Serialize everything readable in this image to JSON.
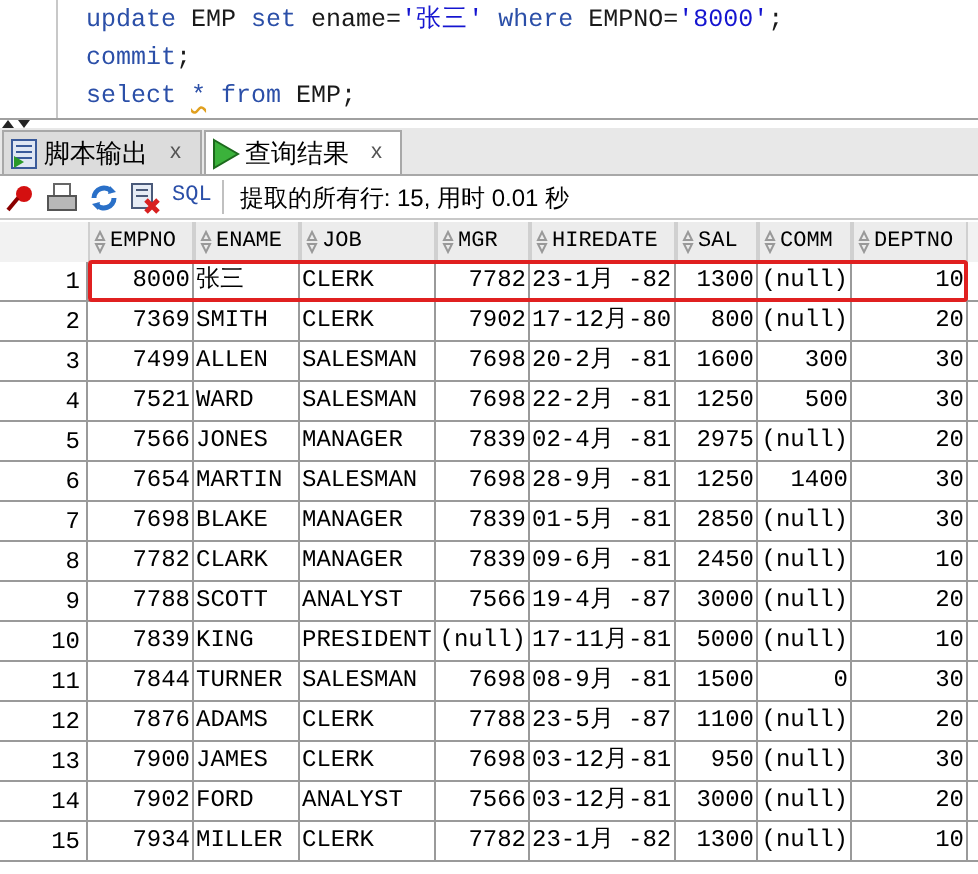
{
  "editor": {
    "lines": [
      [
        {
          "kind": "keyword",
          "text": "update"
        },
        {
          "kind": "ident",
          "text": " EMP "
        },
        {
          "kind": "keyword",
          "text": "set"
        },
        {
          "kind": "ident",
          "text": " ename="
        },
        {
          "kind": "string",
          "text": "'张三' "
        },
        {
          "kind": "keyword",
          "text": "where"
        },
        {
          "kind": "ident",
          "text": " EMPNO="
        },
        {
          "kind": "string",
          "text": "'8000'"
        },
        {
          "kind": "ident",
          "text": ";"
        }
      ],
      [
        {
          "kind": "keyword",
          "text": "commit"
        },
        {
          "kind": "ident",
          "text": ";"
        }
      ],
      [
        {
          "kind": "keyword",
          "text": "select "
        },
        {
          "kind": "keyword",
          "text": "*",
          "warning": true
        },
        {
          "kind": "keyword",
          "text": " from"
        },
        {
          "kind": "ident",
          "text": " EMP;"
        }
      ]
    ]
  },
  "tabs": [
    {
      "label": "脚本输出",
      "close": "x",
      "selected": false
    },
    {
      "label": "查询结果",
      "close": "x",
      "selected": true
    }
  ],
  "toolbar": {
    "sql_button": "SQL",
    "status": "提取的所有行: 15, 用时 0.01 秒"
  },
  "table": {
    "columns": [
      {
        "label": "EMPNO",
        "kind": "number"
      },
      {
        "label": "ENAME",
        "kind": "text"
      },
      {
        "label": "JOB",
        "kind": "text"
      },
      {
        "label": "MGR",
        "kind": "number"
      },
      {
        "label": "HIREDATE",
        "kind": "text"
      },
      {
        "label": "SAL",
        "kind": "number"
      },
      {
        "label": "COMM",
        "kind": "number"
      },
      {
        "label": "DEPTNO",
        "kind": "number"
      }
    ],
    "rows": [
      {
        "num": "1",
        "highlighted": true,
        "cells": [
          "8000",
          "张三",
          "CLERK",
          "7782",
          "23-1月 -82",
          "1300",
          "(null)",
          "10"
        ]
      },
      {
        "num": "2",
        "highlighted": false,
        "cells": [
          "7369",
          "SMITH",
          "CLERK",
          "7902",
          "17-12月-80",
          "800",
          "(null)",
          "20"
        ]
      },
      {
        "num": "3",
        "highlighted": false,
        "cells": [
          "7499",
          "ALLEN",
          "SALESMAN",
          "7698",
          "20-2月 -81",
          "1600",
          "300",
          "30"
        ]
      },
      {
        "num": "4",
        "highlighted": false,
        "cells": [
          "7521",
          "WARD",
          "SALESMAN",
          "7698",
          "22-2月 -81",
          "1250",
          "500",
          "30"
        ]
      },
      {
        "num": "5",
        "highlighted": false,
        "cells": [
          "7566",
          "JONES",
          "MANAGER",
          "7839",
          "02-4月 -81",
          "2975",
          "(null)",
          "20"
        ]
      },
      {
        "num": "6",
        "highlighted": false,
        "cells": [
          "7654",
          "MARTIN",
          "SALESMAN",
          "7698",
          "28-9月 -81",
          "1250",
          "1400",
          "30"
        ]
      },
      {
        "num": "7",
        "highlighted": false,
        "cells": [
          "7698",
          "BLAKE",
          "MANAGER",
          "7839",
          "01-5月 -81",
          "2850",
          "(null)",
          "30"
        ]
      },
      {
        "num": "8",
        "highlighted": false,
        "cells": [
          "7782",
          "CLARK",
          "MANAGER",
          "7839",
          "09-6月 -81",
          "2450",
          "(null)",
          "10"
        ]
      },
      {
        "num": "9",
        "highlighted": false,
        "cells": [
          "7788",
          "SCOTT",
          "ANALYST",
          "7566",
          "19-4月 -87",
          "3000",
          "(null)",
          "20"
        ]
      },
      {
        "num": "10",
        "highlighted": false,
        "cells": [
          "7839",
          "KING",
          "PRESIDENT",
          "(null)",
          "17-11月-81",
          "5000",
          "(null)",
          "10"
        ]
      },
      {
        "num": "11",
        "highlighted": false,
        "cells": [
          "7844",
          "TURNER",
          "SALESMAN",
          "7698",
          "08-9月 -81",
          "1500",
          "0",
          "30"
        ]
      },
      {
        "num": "12",
        "highlighted": false,
        "cells": [
          "7876",
          "ADAMS",
          "CLERK",
          "7788",
          "23-5月 -87",
          "1100",
          "(null)",
          "20"
        ]
      },
      {
        "num": "13",
        "highlighted": false,
        "cells": [
          "7900",
          "JAMES",
          "CLERK",
          "7698",
          "03-12月-81",
          "950",
          "(null)",
          "30"
        ]
      },
      {
        "num": "14",
        "highlighted": false,
        "cells": [
          "7902",
          "FORD",
          "ANALYST",
          "7566",
          "03-12月-81",
          "3000",
          "(null)",
          "20"
        ]
      },
      {
        "num": "15",
        "highlighted": false,
        "cells": [
          "7934",
          "MILLER",
          "CLERK",
          "7782",
          "23-1月 -82",
          "1300",
          "(null)",
          "10"
        ]
      }
    ]
  }
}
